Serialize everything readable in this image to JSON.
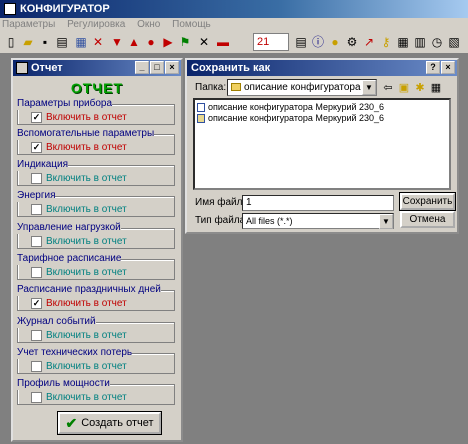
{
  "app": {
    "title": "КОНФИГУРАТОР",
    "menu": [
      "Параметры",
      "Регулировка",
      "Окно",
      "Помощь"
    ],
    "toolbar_field_value": "21"
  },
  "report": {
    "window_title": "Отчет",
    "heading": "ОТЧЕТ",
    "checkbox_label": "Включить в отчет",
    "groups": [
      {
        "label": "Параметры прибора",
        "checked": true
      },
      {
        "label": "Вспомогательные параметры",
        "checked": true
      },
      {
        "label": "Индикация",
        "checked": false
      },
      {
        "label": "Энергия",
        "checked": false
      },
      {
        "label": "Управление нагрузкой",
        "checked": false
      },
      {
        "label": "Тарифное расписание",
        "checked": false
      },
      {
        "label": "Расписание праздничных дней",
        "checked": true
      },
      {
        "label": "Журнал событий",
        "checked": false
      },
      {
        "label": "Учет технических потерь",
        "checked": false
      },
      {
        "label": "Профиль мощности",
        "checked": false
      }
    ],
    "create_button": "Создать отчет"
  },
  "save_dialog": {
    "title": "Сохранить как",
    "folder_label": "Папка:",
    "folder_value": "описание конфигуратора",
    "files": [
      "описание конфигуратора Меркурий 230_6",
      "описание конфигуратора Меркурий 230_6"
    ],
    "filename_label": "Имя файла:",
    "filename_value": "1",
    "filetype_label": "Тип файла:",
    "filetype_value": "All files (*.*)",
    "save_button": "Сохранить",
    "cancel_button": "Отмена"
  }
}
